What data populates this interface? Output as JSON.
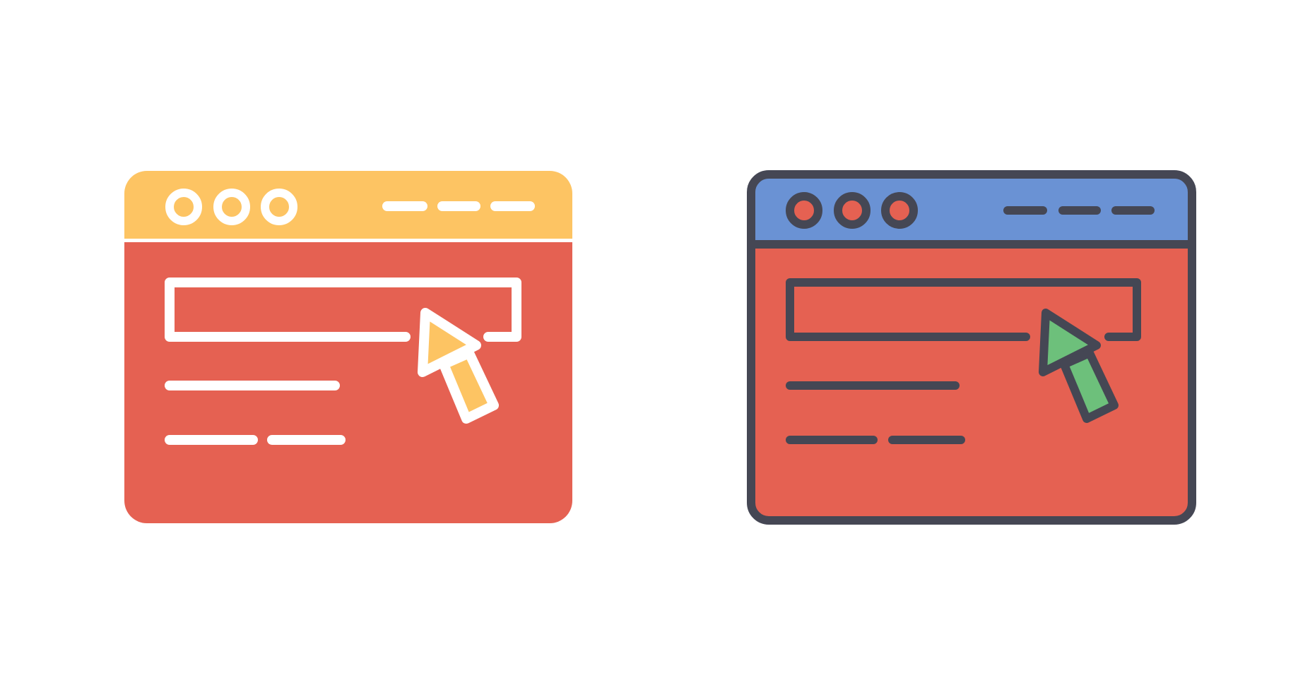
{
  "icons": [
    {
      "name": "browser-search-cursor-icon-flat",
      "style": "flat",
      "colors": {
        "titlebar": "#FDC463",
        "body": "#E56152",
        "stroke": "#FFFFFF",
        "dots": "#FDC463",
        "cursor": "#FDC463"
      }
    },
    {
      "name": "browser-search-cursor-icon-outline",
      "style": "filled-outline",
      "colors": {
        "titlebar": "#6A92D4",
        "body": "#E56152",
        "stroke": "#454754",
        "dots": "#E56152",
        "cursor": "#6DC07B"
      }
    }
  ]
}
